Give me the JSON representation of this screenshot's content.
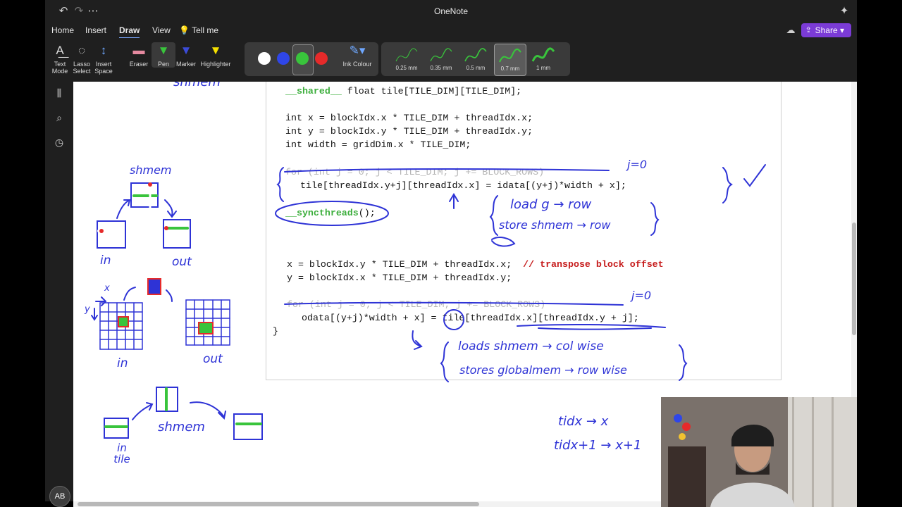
{
  "app": {
    "title": "OneNote"
  },
  "menu": {
    "items": [
      "Home",
      "Insert",
      "Draw",
      "View",
      "Tell me"
    ],
    "active": "Draw",
    "share_label": "Share"
  },
  "ribbon": {
    "tools": {
      "text_mode": "Text Mode",
      "lasso": "Lasso Select",
      "insert_space": "Insert Space",
      "eraser": "Eraser",
      "pen": "Pen",
      "marker": "Marker",
      "highlighter": "Highlighter",
      "ink_colour": "Ink Colour"
    },
    "pen_colors": [
      "#ffffff",
      "#2f46e8",
      "#39c43c",
      "#e62a2a"
    ],
    "selected_color": "#39c43c",
    "pen_widths": [
      "0.25 mm",
      "0.35 mm",
      "0.5 mm",
      "0.7 mm",
      "1 mm"
    ],
    "selected_width": "0.7 mm"
  },
  "user": {
    "initials": "AB"
  },
  "code": {
    "l1_a": "__shared__",
    "l1_b": " float tile[TILE_DIM][TILE_DIM];",
    "l2": "int x = blockIdx.x * TILE_DIM + threadIdx.x;",
    "l3": "int y = blockIdx.y * TILE_DIM + threadIdx.y;",
    "l4": "int width = gridDim.x * TILE_DIM;",
    "l5": "for (int j = 0; j < TILE_DIM; j += BLOCK_ROWS)",
    "l6": "tile[threadIdx.y+j][threadIdx.x] = idata[(y+j)*width + x];",
    "l7_a": "__syncthreads",
    "l7_b": "();",
    "l8_a": "x = blockIdx.y * TILE_DIM + threadIdx.x;",
    "l8_b": "// transpose block offset",
    "l9": "y = blockIdx.x * TILE_DIM + threadIdx.y;",
    "l10": "for (int j = 0; j < TILE_DIM; j += BLOCK_ROWS)",
    "l11": "odata[(y+j)*width + x] = tile[threadIdx.x][threadIdx.y + j];",
    "l12": "}"
  },
  "notes": {
    "top": "shmem",
    "shmem1": "shmem",
    "in1": "in",
    "out1": "out",
    "x_lbl": "x",
    "y_lbl": "y",
    "in2": "in",
    "out2": "out",
    "shmem2": "shmem",
    "in_tile": "in tile",
    "j0_a": "j=0",
    "j0_b": "j=0",
    "load_row": "load g → row",
    "store_row": "store shmem → row",
    "loads_col": "loads shmem → col wise",
    "stores_row": "stores globalmem → row wise",
    "tidx1": "tidx → x",
    "tidx2": "tidx+1 → x+1"
  }
}
